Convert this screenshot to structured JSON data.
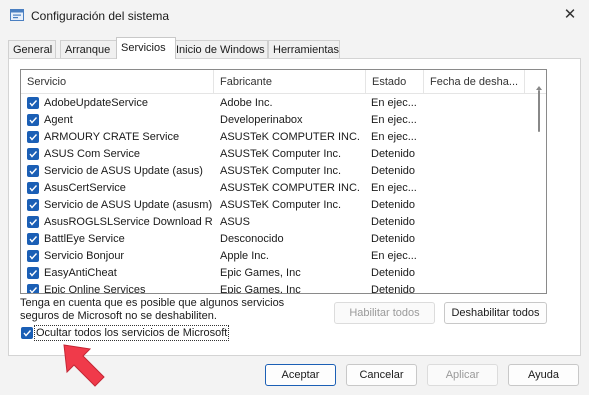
{
  "window": {
    "title": "Configuración del sistema",
    "close_glyph": "✕",
    "icon": "msconfig-icon"
  },
  "tabs": [
    {
      "label": "General",
      "active": false
    },
    {
      "label": "Arranque",
      "active": false
    },
    {
      "label": "Servicios",
      "active": true
    },
    {
      "label": "Inicio de Windows",
      "active": false
    },
    {
      "label": "Herramientas",
      "active": false
    }
  ],
  "services": {
    "columns": [
      "Servicio",
      "Fabricante",
      "Estado",
      "Fecha de desha..."
    ],
    "rows": [
      {
        "name": "AdobeUpdateService",
        "maker": "Adobe Inc.",
        "state": "En ejec...",
        "date": "",
        "checked": true
      },
      {
        "name": "Agent",
        "maker": "Developerinabox",
        "state": "En ejec...",
        "date": "",
        "checked": true
      },
      {
        "name": "ARMOURY CRATE Service",
        "maker": "ASUSTeK COMPUTER INC.",
        "state": "En ejec...",
        "date": "",
        "checked": true
      },
      {
        "name": "ASUS Com Service",
        "maker": "ASUSTeK Computer Inc.",
        "state": "Detenido",
        "date": "",
        "checked": true
      },
      {
        "name": "Servicio de ASUS Update (asus)",
        "maker": "ASUSTeK Computer Inc.",
        "state": "Detenido",
        "date": "",
        "checked": true
      },
      {
        "name": "AsusCertService",
        "maker": "ASUSTeK COMPUTER INC.",
        "state": "En ejec...",
        "date": "",
        "checked": true
      },
      {
        "name": "Servicio de ASUS Update (asusm)",
        "maker": "ASUSTeK Computer Inc.",
        "state": "Detenido",
        "date": "",
        "checked": true
      },
      {
        "name": "AsusROGLSLService Download R...",
        "maker": "ASUS",
        "state": "Detenido",
        "date": "",
        "checked": true
      },
      {
        "name": "BattlEye Service",
        "maker": "Desconocido",
        "state": "Detenido",
        "date": "",
        "checked": true
      },
      {
        "name": "Servicio Bonjour",
        "maker": "Apple Inc.",
        "state": "En ejec...",
        "date": "",
        "checked": true
      },
      {
        "name": "EasyAntiCheat",
        "maker": "Epic Games, Inc",
        "state": "Detenido",
        "date": "",
        "checked": true
      },
      {
        "name": "Epic Online Services",
        "maker": "Epic Games, Inc",
        "state": "Detenido",
        "date": "",
        "checked": true
      }
    ]
  },
  "note": {
    "line1": "Tenga en cuenta que es posible que algunos servicios",
    "line2": "seguros de Microsoft no se deshabiliten."
  },
  "buttons": {
    "enable_all": "Habilitar todos",
    "disable_all": "Deshabilitar todos",
    "ok": "Aceptar",
    "cancel": "Cancelar",
    "apply": "Aplicar",
    "help": "Ayuda"
  },
  "hide_ms": {
    "label": "Ocultar todos los servicios de Microsoft",
    "checked": true
  },
  "colors": {
    "accent": "#1b5fb5",
    "arrow": "#f03a4a"
  }
}
